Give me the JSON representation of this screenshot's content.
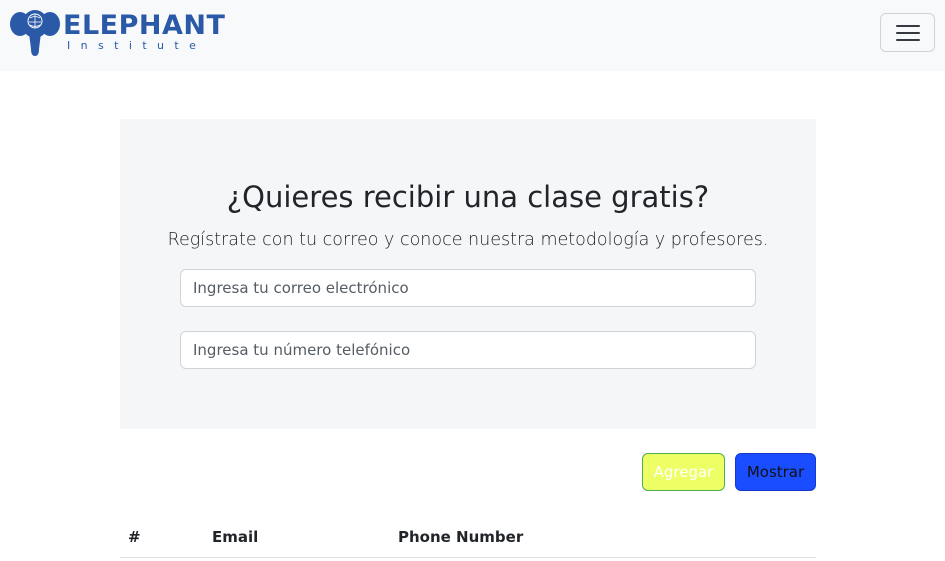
{
  "navbar": {
    "brand_name": "ELEPHANT",
    "brand_sub": "Institute",
    "toggler_icon": "hamburger-menu-icon",
    "colors": {
      "brand": "#2a5aa7",
      "background": "#f8f9fa"
    }
  },
  "hero": {
    "title": "¿Quieres recibir una clase gratis?",
    "subtitle": "Regístrate con tu correo y conoce nuestra metodología y profesores.",
    "email_placeholder": "Ingresa tu correo electrónico",
    "phone_placeholder": "Ingresa tu número telefónico"
  },
  "actions": {
    "add_label": "Agregar",
    "show_label": "Mostrar",
    "colors": {
      "add_bg": "#eeff66",
      "add_border": "#4caf50",
      "show_bg": "#1a4dff"
    }
  },
  "table": {
    "headers": [
      "#",
      "Email",
      "Phone Number"
    ]
  }
}
